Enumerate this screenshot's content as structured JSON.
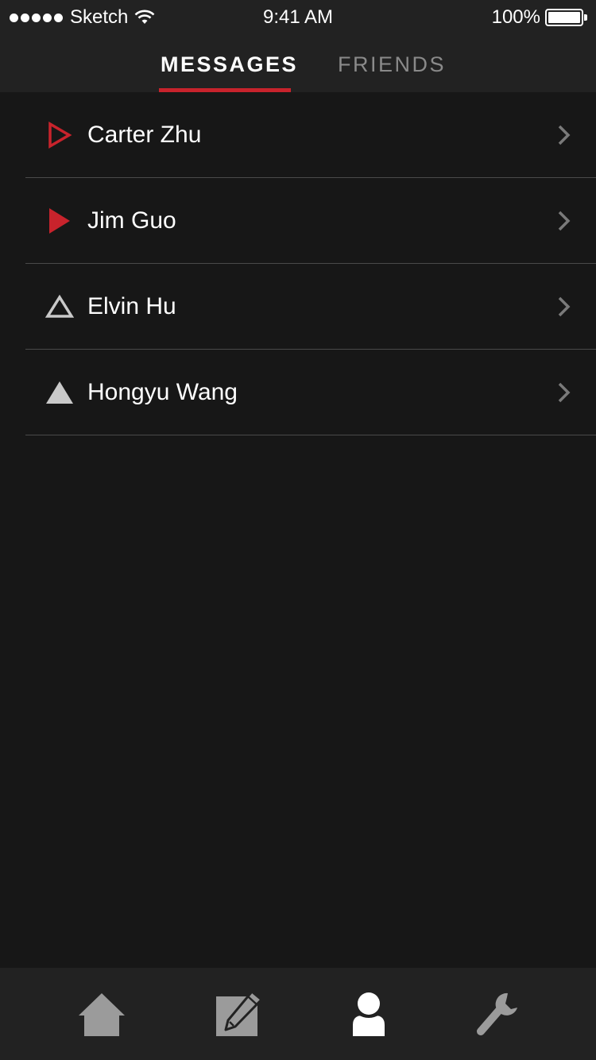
{
  "status_bar": {
    "carrier": "Sketch",
    "time": "9:41 AM",
    "battery": "100%"
  },
  "tabs": {
    "messages": "MESSAGES",
    "friends": "FRIENDS",
    "active": "messages"
  },
  "messages": [
    {
      "name": "Carter Zhu",
      "icon": "outline-play-triangle-icon",
      "icon_color": "#c8232c"
    },
    {
      "name": "Jim Guo",
      "icon": "filled-play-triangle-icon",
      "icon_color": "#c8232c"
    },
    {
      "name": "Elvin Hu",
      "icon": "outline-up-triangle-icon",
      "icon_color": "#c9c9c9"
    },
    {
      "name": "Hongyu Wang",
      "icon": "filled-up-triangle-icon",
      "icon_color": "#c9c9c9"
    }
  ],
  "bottom_nav": [
    {
      "icon": "home-icon"
    },
    {
      "icon": "compose-icon"
    },
    {
      "icon": "profile-icon",
      "active": true
    },
    {
      "icon": "wrench-icon"
    }
  ],
  "colors": {
    "accent": "#c8232c",
    "background": "#171717",
    "bar": "#222222",
    "inactive_icon": "#9b9b9b"
  }
}
